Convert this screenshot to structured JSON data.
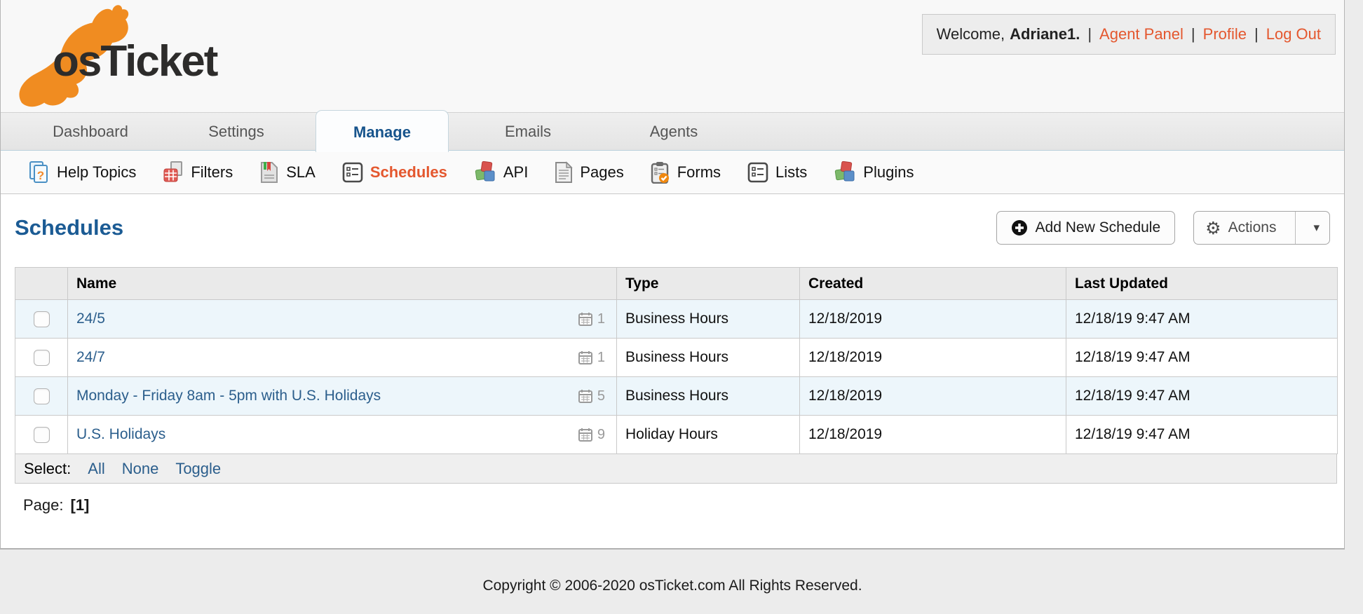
{
  "header": {
    "logo_text": "osTicket",
    "welcome": {
      "prefix": "Welcome,",
      "username": "Adriane1.",
      "separator": "|",
      "links": [
        "Agent Panel",
        "Profile",
        "Log Out"
      ]
    }
  },
  "nav": {
    "tabs": [
      {
        "label": "Dashboard",
        "active": false
      },
      {
        "label": "Settings",
        "active": false
      },
      {
        "label": "Manage",
        "active": true
      },
      {
        "label": "Emails",
        "active": false
      },
      {
        "label": "Agents",
        "active": false
      }
    ]
  },
  "subnav": {
    "items": [
      {
        "label": "Help Topics",
        "icon": "help-topics-icon",
        "active": false
      },
      {
        "label": "Filters",
        "icon": "filters-icon",
        "active": false
      },
      {
        "label": "SLA",
        "icon": "sla-icon",
        "active": false
      },
      {
        "label": "Schedules",
        "icon": "schedules-icon",
        "active": true
      },
      {
        "label": "API",
        "icon": "api-icon",
        "active": false
      },
      {
        "label": "Pages",
        "icon": "pages-icon",
        "active": false
      },
      {
        "label": "Forms",
        "icon": "forms-icon",
        "active": false
      },
      {
        "label": "Lists",
        "icon": "lists-icon",
        "active": false
      },
      {
        "label": "Plugins",
        "icon": "plugins-icon",
        "active": false
      }
    ]
  },
  "main": {
    "title": "Schedules",
    "toolbar": {
      "add_label": "Add New Schedule",
      "actions_label": "Actions"
    },
    "table": {
      "headers": {
        "name": "Name",
        "type": "Type",
        "created": "Created",
        "updated": "Last Updated"
      },
      "rows": [
        {
          "name": "24/5",
          "count": "1",
          "type": "Business Hours",
          "created": "12/18/2019",
          "updated": "12/18/19 9:47 AM"
        },
        {
          "name": "24/7",
          "count": "1",
          "type": "Business Hours",
          "created": "12/18/2019",
          "updated": "12/18/19 9:47 AM"
        },
        {
          "name": "Monday - Friday 8am - 5pm with U.S. Holidays",
          "count": "5",
          "type": "Business Hours",
          "created": "12/18/2019",
          "updated": "12/18/19 9:47 AM"
        },
        {
          "name": "U.S. Holidays",
          "count": "9",
          "type": "Holiday Hours",
          "created": "12/18/2019",
          "updated": "12/18/19 9:47 AM"
        }
      ]
    },
    "select_bar": {
      "label": "Select:",
      "links": [
        "All",
        "None",
        "Toggle"
      ]
    },
    "pagination": {
      "label": "Page:",
      "current": "[1]"
    }
  },
  "footer": {
    "copyright": "Copyright © 2006-2020 osTicket.com All Rights Reserved."
  },
  "icons": {
    "gear": "⚙",
    "arrow_down": "▾"
  },
  "colors": {
    "accent_orange": "#e4572e",
    "logo_orange": "#f08c21",
    "heading_blue": "#1b5b94",
    "active_tab_blue": "#17548c",
    "link_blue": "#2b5e8c",
    "row_alt_blue": "#edf6fb"
  }
}
